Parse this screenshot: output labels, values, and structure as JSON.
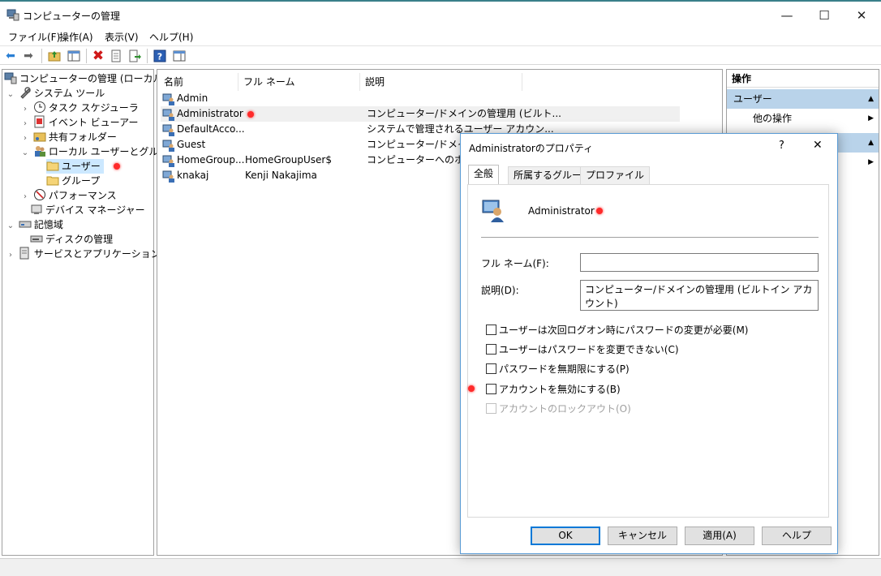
{
  "window": {
    "title": "コンピューターの管理",
    "minimize": "—",
    "maximize": "☐",
    "close": "✕"
  },
  "menu": [
    "ファイル(F)",
    "操作(A)",
    "表示(V)",
    "ヘルプ(H)"
  ],
  "toolbar": {
    "back": "back-arrow-icon",
    "forward": "forward-arrow-icon",
    "up": "up-folder-icon",
    "show_hide": "console-tree-icon",
    "delete": "delete-x-icon",
    "properties": "properties-icon",
    "export": "export-list-icon",
    "help": "help-icon",
    "view": "view-pane-icon"
  },
  "tree": {
    "root": "コンピューターの管理 (ローカル)",
    "system_tools": "システム ツール",
    "task_scheduler": "タスク スケジューラ",
    "event_viewer": "イベント ビューアー",
    "shared_folders": "共有フォルダー",
    "local_users_groups": "ローカル ユーザーとグループ",
    "users": "ユーザー",
    "groups": "グループ",
    "performance": "パフォーマンス",
    "device_manager": "デバイス マネージャー",
    "storage": "記憶域",
    "disk_management": "ディスクの管理",
    "services_apps": "サービスとアプリケーション"
  },
  "list": {
    "headers": [
      "名前",
      "フル ネーム",
      "説明"
    ],
    "rows": [
      {
        "name": "Admin",
        "full": "",
        "desc": ""
      },
      {
        "name": "Administrator",
        "full": "",
        "desc": "コンピューター/ドメインの管理用 (ビルト..."
      },
      {
        "name": "DefaultAcco...",
        "full": "",
        "desc": "システムで管理されるユーザー アカウン..."
      },
      {
        "name": "Guest",
        "full": "",
        "desc": "コンピューター/ドメインへの"
      },
      {
        "name": "HomeGroup...",
        "full": "HomeGroupUser$",
        "desc": "コンピューターへのホームグ"
      },
      {
        "name": "knakaj",
        "full": "Kenji Nakajima",
        "desc": ""
      }
    ]
  },
  "actions": {
    "header": "操作",
    "section1": "ユーザー",
    "more": "他の操作"
  },
  "dialog": {
    "title": "Administratorのプロパティ",
    "help": "?",
    "close": "✕",
    "tabs": [
      "全般",
      "所属するグループ",
      "プロファイル"
    ],
    "user_name": "Administrator",
    "fullname_label": "フル ネーム(F):",
    "fullname_value": "",
    "desc_label": "説明(D):",
    "desc_value": "コンピューター/ドメインの管理用 (ビルトイン アカウント)",
    "checkboxes": [
      {
        "label": "ユーザーは次回ログオン時にパスワードの変更が必要(M)",
        "checked": false,
        "disabled": false
      },
      {
        "label": "ユーザーはパスワードを変更できない(C)",
        "checked": false,
        "disabled": false
      },
      {
        "label": "パスワードを無期限にする(P)",
        "checked": false,
        "disabled": false
      },
      {
        "label": "アカウントを無効にする(B)",
        "checked": false,
        "disabled": false
      },
      {
        "label": "アカウントのロックアウト(O)",
        "checked": false,
        "disabled": true
      }
    ],
    "buttons": {
      "ok": "OK",
      "cancel": "キャンセル",
      "apply": "適用(A)",
      "help": "ヘルプ"
    }
  },
  "colors": {
    "accent": "#0078d7",
    "selection": "#cce8ff",
    "actions_section": "#b9d3ea",
    "marker": "#ff2a2a"
  }
}
